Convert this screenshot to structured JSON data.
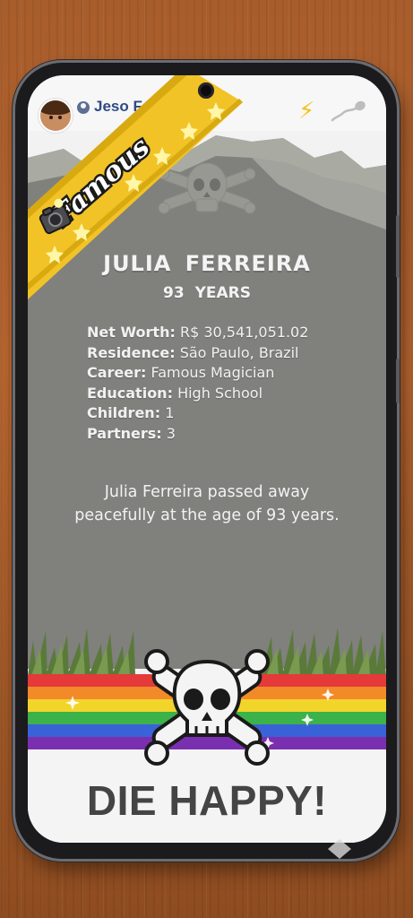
{
  "header": {
    "user_name": "Jeso Fe",
    "avatar_icon": "avatar-face-icon",
    "profile_icon": "person-icon",
    "bolt_icon": "lightning-icon",
    "sperm_icon": "sperm-icon"
  },
  "banner": {
    "label": "Famous",
    "camera_icon": "camera-icon"
  },
  "obituary": {
    "name": "JULIA FERREIRA",
    "age": "93 YEARS",
    "stats": [
      {
        "label": "Net Worth:",
        "value": "R$ 30,541,051.02"
      },
      {
        "label": "Residence:",
        "value": "São Paulo, Brazil"
      },
      {
        "label": "Career:",
        "value": "Famous Magician"
      },
      {
        "label": "Education:",
        "value": "High School"
      },
      {
        "label": "Children:",
        "value": "1"
      },
      {
        "label": "Partners:",
        "value": "3"
      }
    ],
    "epitaph": "Julia Ferreira passed away peacefully at the age of 93 years."
  },
  "footer": {
    "title": "DIE HAPPY!",
    "skull_icon": "skull-crossbones-icon"
  },
  "colors": {
    "stone": "#7f7f7c",
    "banner_yellow": "#f2c326",
    "title_gray": "#444444",
    "username_blue": "#2f4a86"
  }
}
